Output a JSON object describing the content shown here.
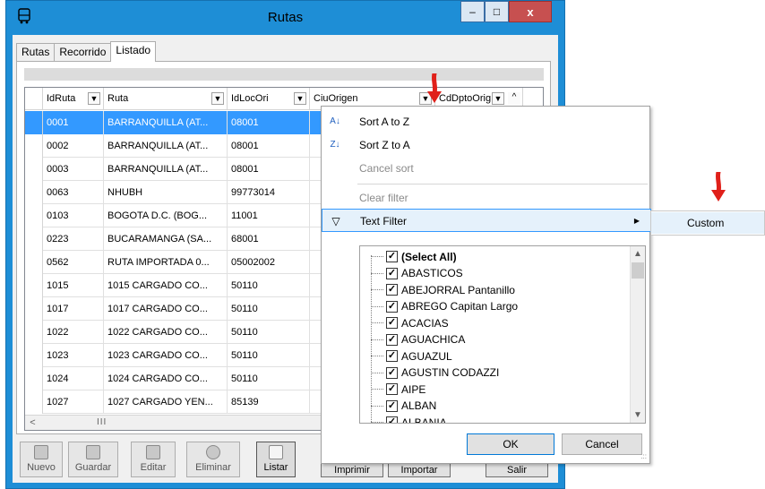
{
  "window": {
    "title": "Rutas",
    "minimize": "‒",
    "maximize": "□",
    "close": "x"
  },
  "tabs": [
    {
      "label": "Rutas",
      "active": false
    },
    {
      "label": "Recorrido",
      "active": false
    },
    {
      "label": "Listado",
      "active": true
    }
  ],
  "grid": {
    "columns": [
      "IdRuta",
      "Ruta",
      "IdLocOri",
      "CiuOrigen",
      "CdDptoOrig"
    ],
    "rows": [
      [
        "0001",
        "BARRANQUILLA  (AT...",
        "08001"
      ],
      [
        "0002",
        "BARRANQUILLA  (AT...",
        "08001"
      ],
      [
        "0003",
        "BARRANQUILLA  (AT...",
        "08001"
      ],
      [
        "0063",
        "NHUBH",
        "99773014"
      ],
      [
        "0103",
        "BOGOTA D.C. (BOG...",
        "11001"
      ],
      [
        "0223",
        "BUCARAMANGA (SA...",
        "68001"
      ],
      [
        "0562",
        "RUTA IMPORTADA 0...",
        "05002002"
      ],
      [
        "1015",
        "1015 CARGADO CO...",
        "50110"
      ],
      [
        "1017",
        "1017 CARGADO CO...",
        "50110"
      ],
      [
        "1022",
        "1022 CARGADO CO...",
        "50110"
      ],
      [
        "1023",
        "1023 CARGADO CO...",
        "50110"
      ],
      [
        "1024",
        "1024 CARGADO CO...",
        "50110"
      ],
      [
        "1027",
        "1027 CARGADO YEN...",
        "85139"
      ]
    ],
    "scroll_grip": "III",
    "scroll_left": "<"
  },
  "toolbar": {
    "nuevo": "Nuevo",
    "guardar": "Guardar",
    "editar": "Editar",
    "eliminar": "Eliminar",
    "listar": "Listar",
    "imprimir": "Imprimir",
    "importar": "Importar",
    "salir": "Salir"
  },
  "menu": {
    "sort_az": "Sort A to Z",
    "sort_za": "Sort Z to A",
    "cancel_sort": "Cancel sort",
    "clear_filter": "Clear filter",
    "text_filter": "Text Filter",
    "submenu_custom": "Custom",
    "checklist": [
      {
        "label": "(Select All)",
        "checked": true
      },
      {
        "label": "ABASTICOS",
        "checked": true
      },
      {
        "label": "ABEJORRAL Pantanillo",
        "checked": true
      },
      {
        "label": "ABREGO Capitan Largo",
        "checked": true
      },
      {
        "label": "ACACIAS",
        "checked": true
      },
      {
        "label": "AGUACHICA",
        "checked": true
      },
      {
        "label": "AGUAZUL",
        "checked": true
      },
      {
        "label": "AGUSTIN CODAZZI",
        "checked": true
      },
      {
        "label": "AIPE",
        "checked": true
      },
      {
        "label": "ALBAN",
        "checked": true
      },
      {
        "label": "ALBANIA",
        "checked": true
      }
    ],
    "ok": "OK",
    "cancel": "Cancel"
  },
  "colors": {
    "titlebar": "#1e8ed6",
    "selection": "#3399ff",
    "arrow": "#e0201a"
  }
}
